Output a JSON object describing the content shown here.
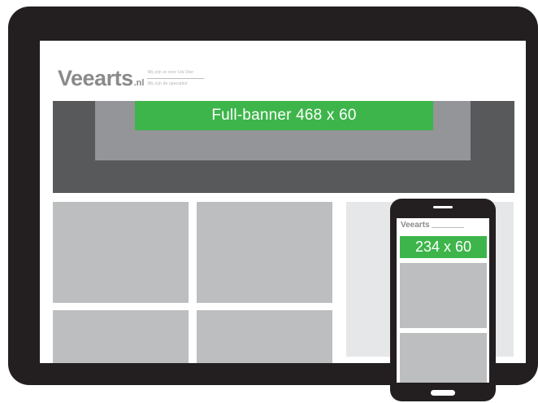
{
  "desktop": {
    "logo": {
      "wordmark": "Veearts",
      "tld": ".nl",
      "tagline_1": "Wij zijn er voor Uw Dier",
      "tagline_2": "Wij zijn de specialist"
    },
    "banner_label": "Full-banner 468 x 60"
  },
  "mobile": {
    "logo": {
      "wordmark": "Veearts"
    },
    "banner_label": "234 x 60"
  },
  "colors": {
    "device_frame": "#231f20",
    "hero_dark": "#58595b",
    "hero_mid": "#939598",
    "banner_green": "#3db54a",
    "tile_gray": "#bcbec0",
    "sidepanel": "#e6e7e8"
  }
}
